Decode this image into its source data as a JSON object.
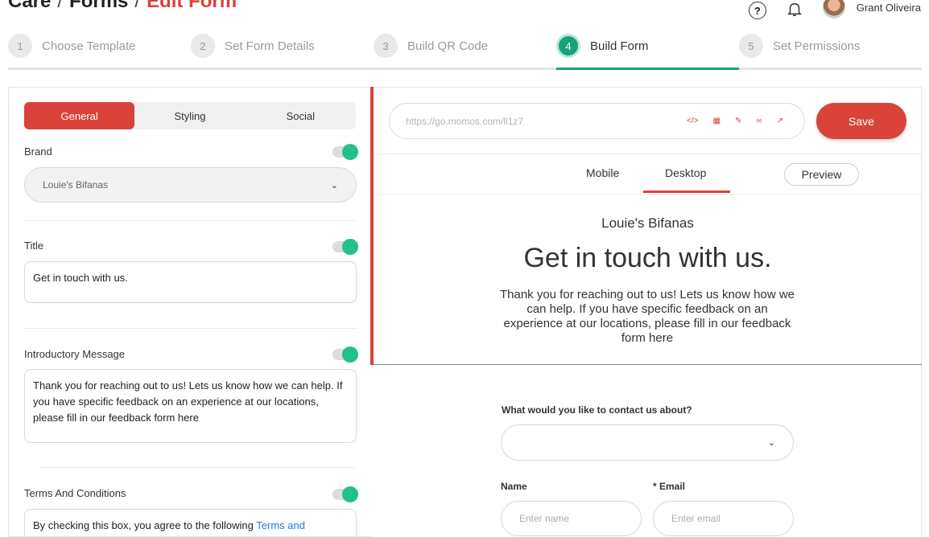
{
  "breadcrumb": {
    "part1": "Care",
    "part2": "Forms",
    "current": "Edit Form"
  },
  "header": {
    "help_icon": "question-circle-icon",
    "bell_icon": "bell-icon",
    "user_name": "Grant Oliveira"
  },
  "steps": [
    {
      "num": "1",
      "label": "Choose Template"
    },
    {
      "num": "2",
      "label": "Set Form Details"
    },
    {
      "num": "3",
      "label": "Build QR Code"
    },
    {
      "num": "4",
      "label": "Build Form",
      "active": true
    },
    {
      "num": "5",
      "label": "Set Permissions"
    }
  ],
  "left": {
    "tabs": [
      "General",
      "Styling",
      "Social"
    ],
    "brand_label": "Brand",
    "brand_value": "Louie's Bifanas",
    "title_label": "Title",
    "title_value": "Get in touch with us.",
    "intro_label": "Introductory Message",
    "intro_value": "Thank you for reaching out to us! Lets us know how we can help. If you have specific feedback on an experience at our locations, please fill in our feedback form here",
    "terms_label": "Terms And Conditions",
    "terms_text": "By checking this box, you agree to the following",
    "terms_link": "Terms and"
  },
  "right": {
    "url": "https://go.momos.com/ll1z7",
    "save_label": "Save",
    "view_tabs": {
      "mobile": "Mobile",
      "desktop": "Desktop"
    },
    "preview_label": "Preview",
    "preview": {
      "brand": "Louie's Bifanas",
      "title": "Get in touch with us.",
      "intro": "Thank you for reaching out to us! Lets us know how we can help. If you have specific feedback on an experience at our locations, please fill in our feedback form here",
      "question_label": "What would you like to contact us about?",
      "name_label": "Name",
      "email_label": "* Email",
      "name_placeholder": "Enter name",
      "email_placeholder": "Enter email"
    }
  },
  "colors": {
    "accent": "#d9433a",
    "active_step": "#17a27a",
    "toggle": "#22c08c"
  }
}
